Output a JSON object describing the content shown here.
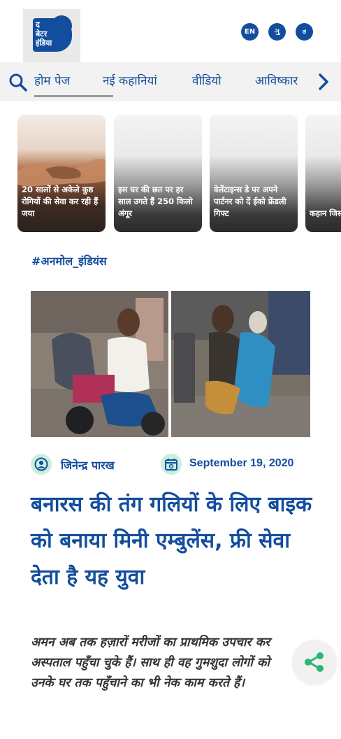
{
  "header": {
    "logo_lines": [
      "द",
      "बेटर",
      "इंडिया"
    ],
    "languages": [
      "EN",
      "ગુ",
      "ಠ"
    ]
  },
  "nav": {
    "items": [
      "होम पेज",
      "नई कहानियां",
      "वीडियो",
      "आविष्कार"
    ]
  },
  "stories": [
    {
      "title": "20 सालों से अकेले कुष्ठ रोगियों की सेवा कर रही हैं जया"
    },
    {
      "title": "इस घर की छत पर हर साल उगते हैं 250 किलो अंगूर"
    },
    {
      "title": "वेलेंटाइन्स डे पर अपने पार्टनर को दें ईको फ्रेंडली गिफ्ट"
    },
    {
      "title": "कहान जिस दुनिय"
    }
  ],
  "article": {
    "tag": "#अनमोल_इंडियंस",
    "author": "जिनेन्द्र पारख",
    "date": "September 19, 2020",
    "title": "बनारस की तंग गलियों के लिए बाइक को बनाया मिनी एम्बुलेंस, फ्री सेवा देता है यह युवा",
    "summary": "अमन अब तक हज़ारों मरीजों का प्राथमिक उपचार कर अस्पताल पहुँचा चुके हैं। साथ ही वह गुमशुदा लोगों को उनके घर तक पहुँचाने का भी नेक काम करते हैं।"
  },
  "colors": {
    "brand": "#134d9e",
    "accent": "#2bb673",
    "icon_bg": "#c9eedd"
  }
}
